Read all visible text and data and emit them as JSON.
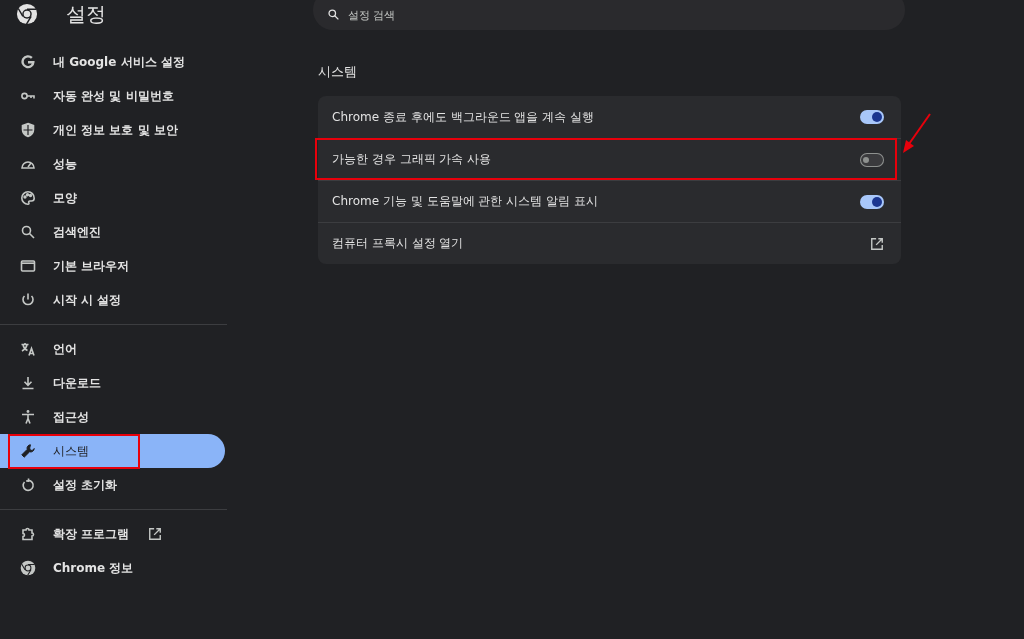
{
  "header": {
    "title": "설정"
  },
  "search": {
    "placeholder": "설정 검색"
  },
  "sidebar": {
    "groups": [
      {
        "items": [
          {
            "label": "내 Google 서비스 설정",
            "selected": false,
            "highlighted": false,
            "kind": "page"
          },
          {
            "label": "자동 완성 및 비밀번호",
            "selected": false,
            "highlighted": false,
            "kind": "page"
          },
          {
            "label": "개인 정보 보호 및 보안",
            "selected": false,
            "highlighted": false,
            "kind": "page"
          },
          {
            "label": "성능",
            "selected": false,
            "highlighted": false,
            "kind": "page"
          },
          {
            "label": "모양",
            "selected": false,
            "highlighted": false,
            "kind": "page"
          },
          {
            "label": "검색엔진",
            "selected": false,
            "highlighted": false,
            "kind": "page"
          },
          {
            "label": "기본 브라우저",
            "selected": false,
            "highlighted": false,
            "kind": "page"
          },
          {
            "label": "시작 시 설정",
            "selected": false,
            "highlighted": false,
            "kind": "page"
          }
        ]
      },
      {
        "items": [
          {
            "label": "언어",
            "selected": false,
            "highlighted": false,
            "kind": "page"
          },
          {
            "label": "다운로드",
            "selected": false,
            "highlighted": false,
            "kind": "page"
          },
          {
            "label": "접근성",
            "selected": false,
            "highlighted": false,
            "kind": "page"
          },
          {
            "label": "시스템",
            "selected": true,
            "highlighted": true,
            "kind": "page"
          },
          {
            "label": "설정 초기화",
            "selected": false,
            "highlighted": false,
            "kind": "page"
          }
        ]
      },
      {
        "items": [
          {
            "label": "확장 프로그램",
            "selected": false,
            "highlighted": false,
            "kind": "external"
          },
          {
            "label": "Chrome 정보",
            "selected": false,
            "highlighted": false,
            "kind": "page"
          }
        ]
      }
    ]
  },
  "section": {
    "title": "시스템",
    "rows": [
      {
        "label": "Chrome 종료 후에도 백그라운드 앱을 계속 실행",
        "kind": "toggle",
        "on": true,
        "highlighted": false
      },
      {
        "label": "가능한 경우 그래픽 가속 사용",
        "kind": "toggle",
        "on": false,
        "highlighted": true
      },
      {
        "label": "Chrome 기능 및 도움말에 관한 시스템 알림 표시",
        "kind": "toggle",
        "on": true,
        "highlighted": false
      },
      {
        "label": "컴퓨터 프록시 설정 열기",
        "kind": "link",
        "highlighted": false
      }
    ]
  }
}
